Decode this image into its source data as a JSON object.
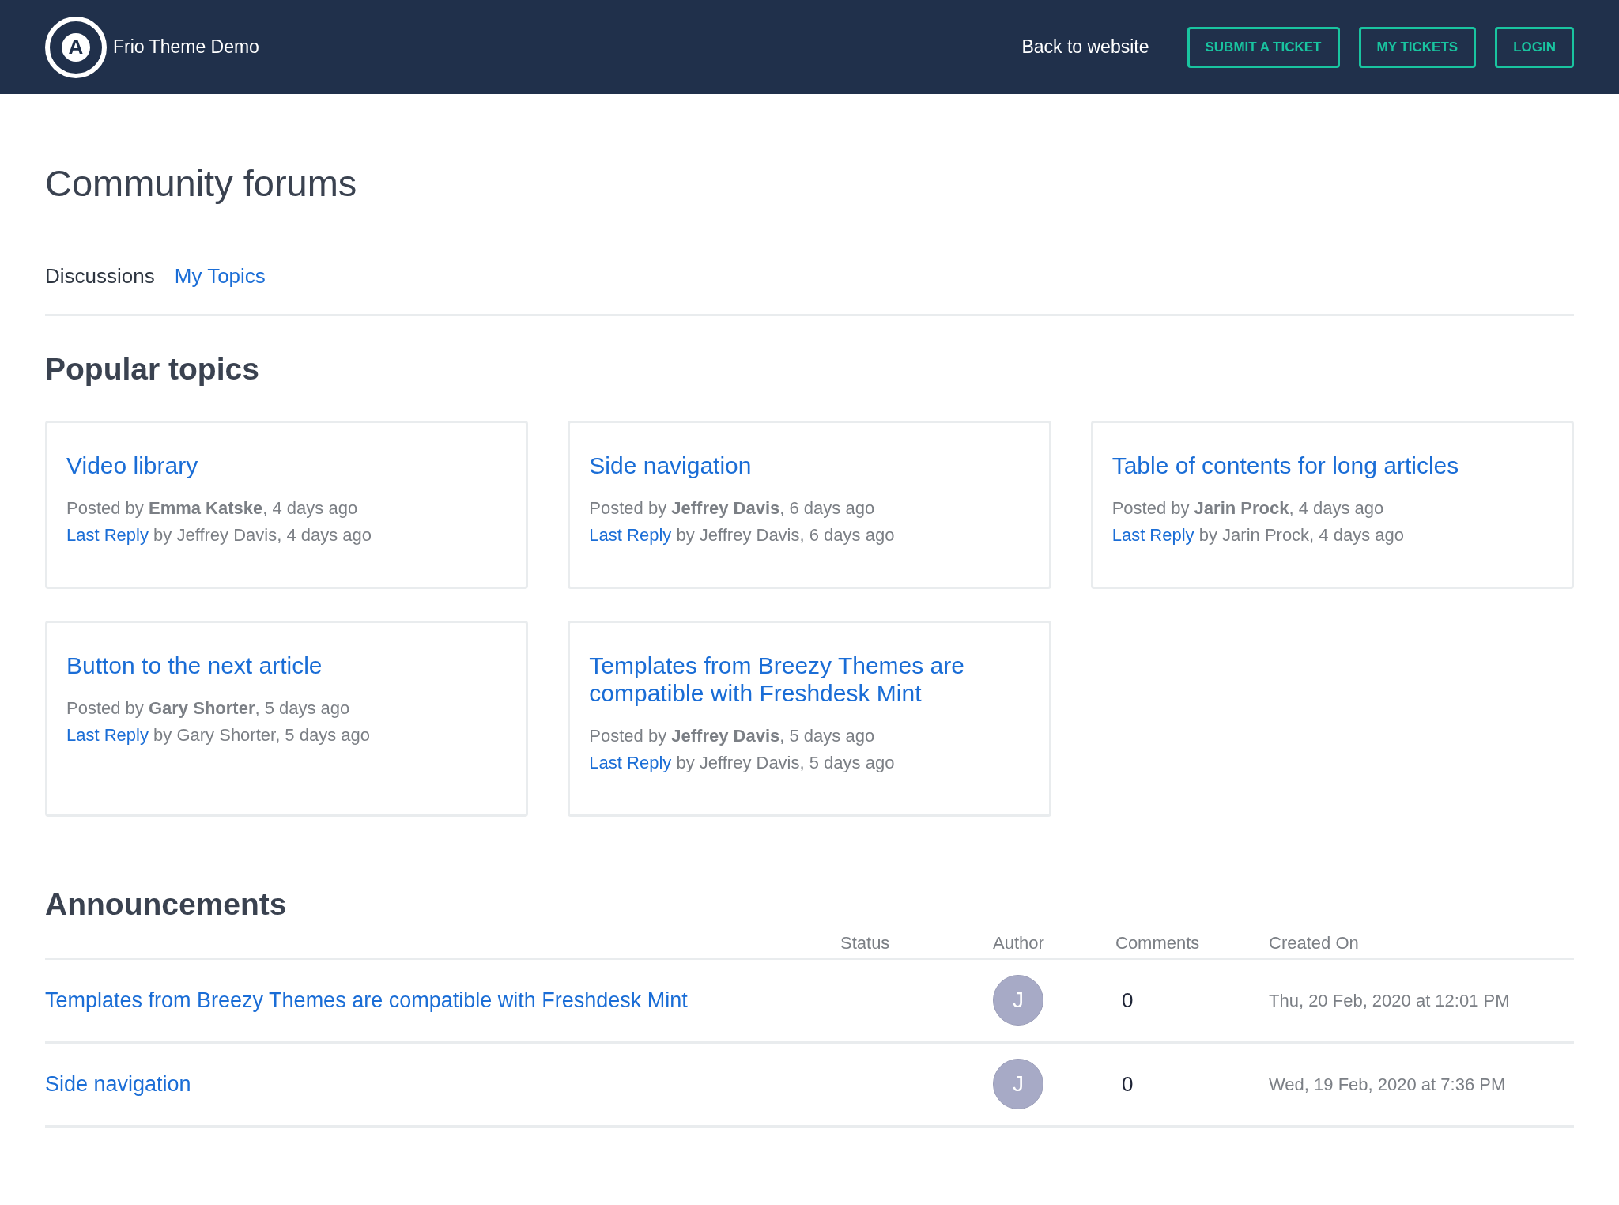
{
  "header": {
    "logo_letter": "A",
    "site_name": "Frio Theme Demo",
    "back_link": "Back to website",
    "buttons": [
      "SUBMIT A TICKET",
      "MY TICKETS",
      "LOGIN"
    ]
  },
  "page_title": "Community forums",
  "tabs": [
    {
      "label": "Discussions",
      "selected": true
    },
    {
      "label": "My Topics",
      "selected": false
    }
  ],
  "popular": {
    "heading": "Popular topics",
    "cards": [
      {
        "title": "Video library",
        "posted": "Posted by **Emma Katske**, 4 days ago",
        "reply_link": "Last Reply",
        "reply": "by Jeffrey Davis, 4 days ago"
      },
      {
        "title": "Side navigation",
        "posted": "Posted by **Jeffrey Davis**, 6 days ago",
        "reply_link": "Last Reply",
        "reply": "by Jeffrey Davis, 6 days ago"
      },
      {
        "title": "Table of contents for long articles",
        "posted": "Posted by **Jarin Prock**, 4 days ago",
        "reply_link": "Last Reply",
        "reply": "by Jarin Prock, 4 days ago"
      },
      {
        "title": "Button to the next article",
        "posted": "Posted by **Gary Shorter**, 5 days ago",
        "reply_link": "Last Reply",
        "reply": "by Gary Shorter, 5 days ago"
      },
      {
        "title": "Templates from Breezy Themes are compatible with Freshdesk Mint",
        "posted": "Posted by **Jeffrey Davis**, 5 days ago",
        "reply_link": "Last Reply",
        "reply": "by Jeffrey Davis, 5 days ago"
      }
    ]
  },
  "announcements": {
    "heading": "Announcements",
    "columns": [
      "Status",
      "Author",
      "Comments",
      "Created On"
    ],
    "rows": [
      {
        "title": "Templates from Breezy Themes are compatible with Freshdesk Mint",
        "avatar_letter": "J",
        "comments": "0",
        "created": "Thu, 20 Feb, 2020 at 12:01 PM"
      },
      {
        "title": "Side navigation",
        "avatar_letter": "J",
        "comments": "0",
        "created": "Wed, 19 Feb, 2020 at 7:36 PM"
      }
    ]
  }
}
